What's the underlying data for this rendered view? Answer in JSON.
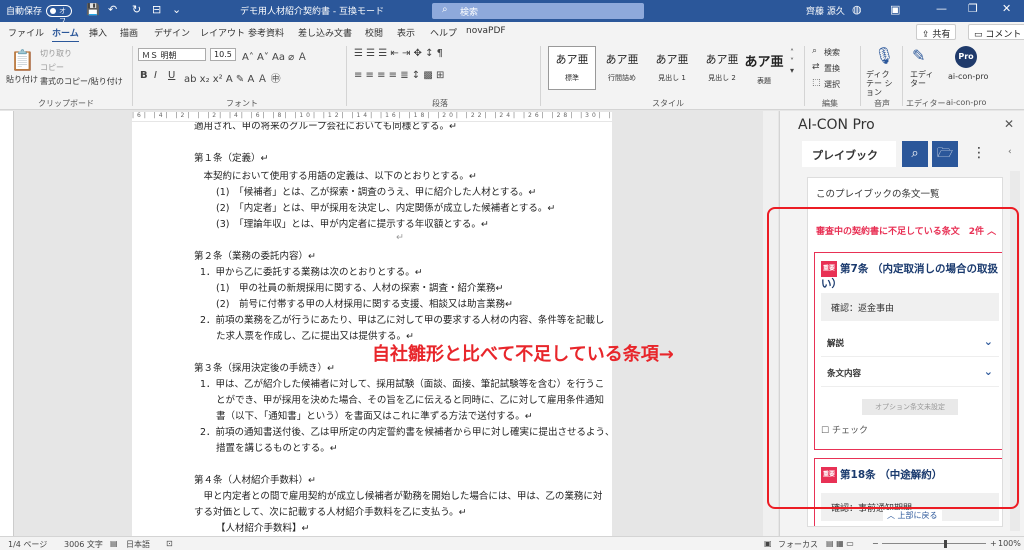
{
  "titlebar": {
    "autosave_label": "自動保存",
    "autosave_state": "オフ",
    "doc_title": "デモ用人材紹介契約書 - 互換モード",
    "search_placeholder": "検索",
    "user": "齊藤 源久",
    "minimize": "—",
    "restore": "❐",
    "close": "✕"
  },
  "tabs": [
    "ファイル",
    "ホーム",
    "挿入",
    "描画",
    "デザイン",
    "レイアウト",
    "参考資料",
    "差し込み文書",
    "校閲",
    "表示",
    "ヘルプ",
    "novaPDF"
  ],
  "share_label": "共有",
  "comment_label": "コメント",
  "ribbon": {
    "clipboard": {
      "paste": "貼り付け",
      "cut": "切り取り",
      "copy": "コピー",
      "format_painter": "書式のコピー/貼り付け",
      "label": "クリップボード"
    },
    "font": {
      "name": "ＭＳ 明朝",
      "size": "10.5",
      "label": "フォント",
      "bold": "B",
      "italic": "I",
      "underline": "U"
    },
    "paragraph": {
      "label": "段落"
    },
    "styles": {
      "items": [
        {
          "preview": "あア亜",
          "name": "標準"
        },
        {
          "preview": "あア亜",
          "name": "行間詰め"
        },
        {
          "preview": "あア亜",
          "name": "見出し 1"
        },
        {
          "preview": "あア亜",
          "name": "見出し 2"
        },
        {
          "preview": "あア亜",
          "name": "表題"
        }
      ],
      "label": "スタイル"
    },
    "editing": {
      "find": "検索",
      "replace": "置換",
      "select": "選択",
      "label": "編集"
    },
    "voice": {
      "dictate": "ディクテー ション",
      "label": "音声"
    },
    "editor": {
      "name": "エディ ター",
      "label": "エディター"
    },
    "aicon": {
      "icon": "Pro",
      "name": "ai-con-pro",
      "label": "ai-con-pro"
    }
  },
  "ruler": "|6| |4| |2| | |2| |4| |6| |8| |10| |12| |14| |16| |18| |20| |22| |24| |26| |28| |30| |32| |34| |36| |38| |40|",
  "document": {
    "lines": [
      "適用され、甲の将来のグループ会社においても同様とする。↵",
      "第１条（定義）↵",
      "　本契約において使用する用語の定義は、以下のとおりとする。↵",
      "(1)　「候補者」とは、乙が探索・調査のうえ、甲に紹介した人材とする。↵",
      "(2)　「内定者」とは、甲が採用を決定し、内定関係が成立した候補者とする。↵",
      "(3)　「理論年収」とは、甲が内定者に提示する年収額とする。↵",
      "↵",
      "第２条（業務の委託内容）↵",
      "1．甲から乙に委託する業務は次のとおりとする。↵",
      "(1)　甲の社員の新規採用に関する、人材の探索・調査・紹介業務↵",
      "(2)　前号に付帯する甲の人材採用に関する支援、相談又は助言業務↵",
      "2．前項の業務を乙が行うにあたり、甲は乙に対して甲の要求する人材の内容、条件等を記載し",
      "た求人票を作成し、乙に提出又は提供する。↵",
      "第３条（採用決定後の手続き）↵",
      "1．甲は、乙が紹介した候補者に対して、採用試験（面談、面接、筆記試験等を含む）を行うこ",
      "とができ、甲が採用を決めた場合、その旨を乙に伝えると同時に、乙に対して雇用条件通知",
      "書（以下、「通知書」という）を書面又はこれに準ずる方法で送付する。↵",
      "2．前項の通知書送付後、乙は甲所定の内定誓約書を候補者から甲に対し確実に提出させるよう、",
      "措置を講じるものとする。↵",
      "第４条（人材紹介手数料）↵",
      "　甲と内定者との間で雇用契約が成立し候補者が勤務を開始した場合には、甲は、乙の業務に対",
      "する対価として、次に記載する人材紹介手数料を乙に支払う。↵",
      "【人材紹介手数料】↵"
    ]
  },
  "callout": "自社雛形と比べて不足している条項→",
  "pane": {
    "title": "AI-CON Pro",
    "close": "✕",
    "tab": "プレイブック",
    "search_icon": "search",
    "folder_icon": "folder",
    "list_link": "このプレイブックの条文一覧",
    "missing_header": "審査中の契約書に不足している条文　2件 ︿",
    "badge": "重要",
    "card1": {
      "title": "第7条 （内定取消しの場合の取扱い）",
      "confirm": "確認：返金事由",
      "explain": "解説",
      "content": "条文内容",
      "option_btn": "オプション条文未設定",
      "check": "チェック"
    },
    "card2": {
      "title": "第18条 （中途解約）",
      "confirm": "確認：事前通知期間"
    },
    "back_to_top": "︿ 上部に戻る"
  },
  "status": {
    "page": "1/4 ページ",
    "words": "3006 文字",
    "lang": "日本語",
    "focus": "フォーカス",
    "zoom": "100%"
  },
  "colors": {
    "accent": "#2b579a",
    "warning": "#e83155",
    "annotation": "#ec1c24"
  }
}
